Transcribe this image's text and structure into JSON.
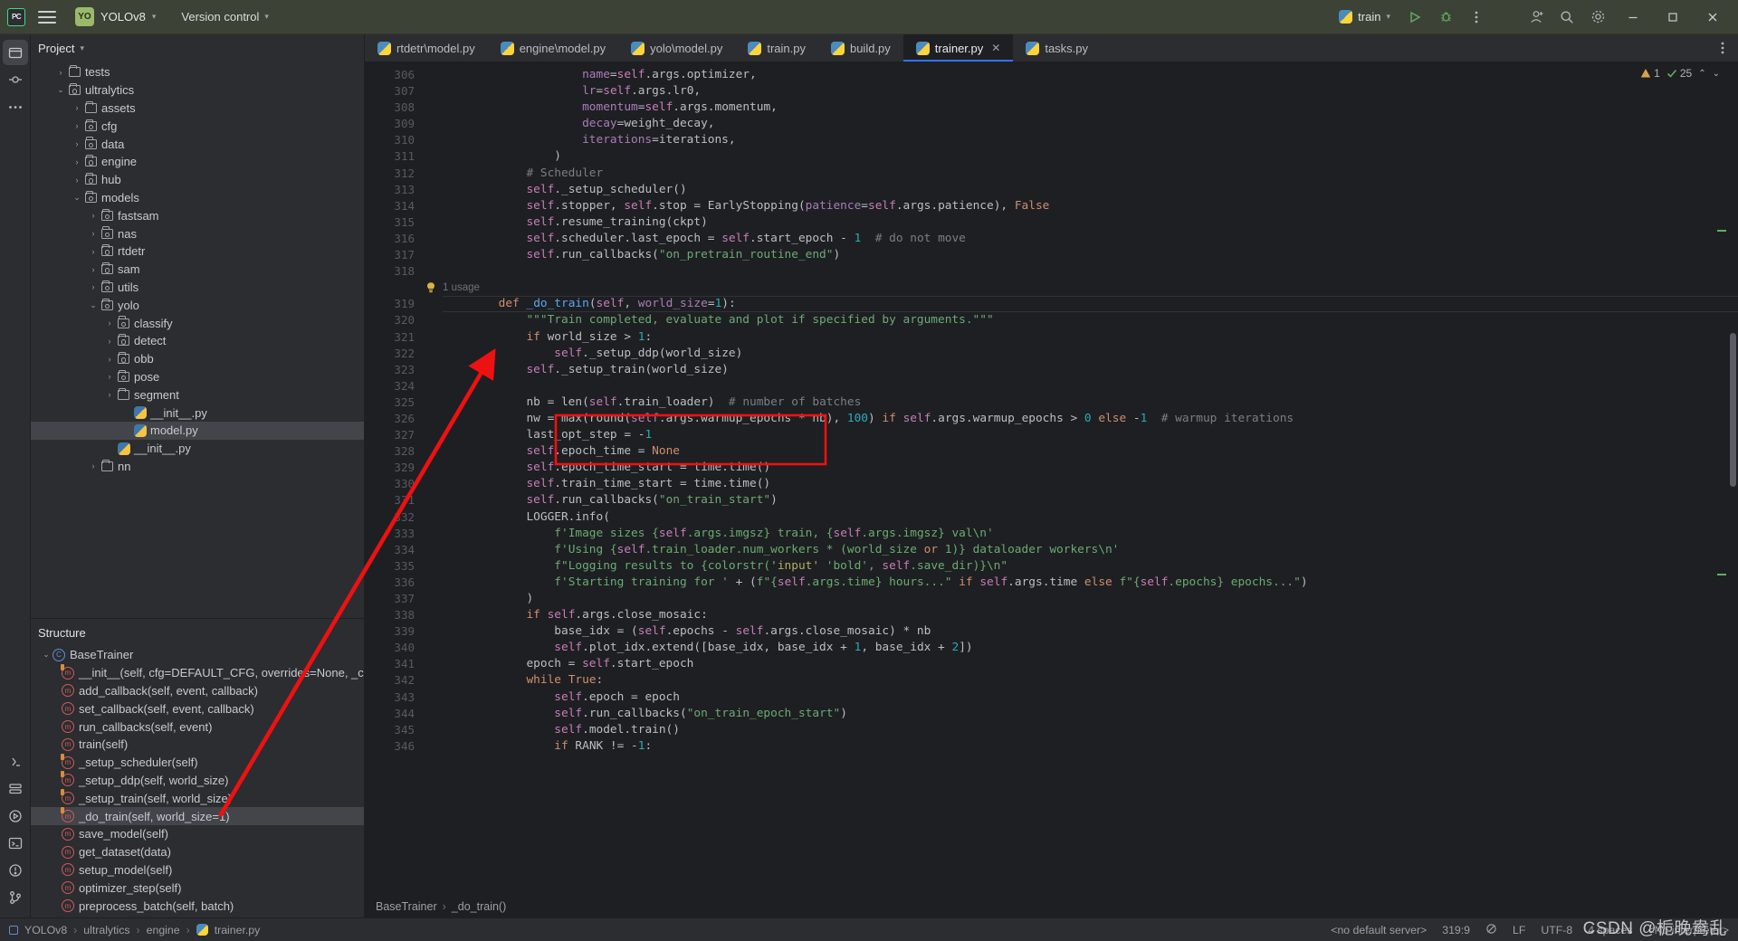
{
  "toolbar": {
    "app_icon": "pycharm-logo-icon",
    "menu_icon": "hamburger-menu-icon",
    "project_badge": "YO",
    "project_name": "YOLOv8",
    "version_control": "Version control",
    "run_config": "train",
    "run_icon": "run-play-icon",
    "debug_icon": "debug-bug-icon",
    "more_icon": "more-vertical-icon",
    "account_icon": "account-icon",
    "search_icon": "search-icon",
    "settings_icon": "gear-icon",
    "minimize": "window-minimize-icon",
    "maximize": "window-maximize-icon",
    "close": "window-close-icon"
  },
  "rail": {
    "top_icons": [
      "project-folder-icon",
      "commit-icon",
      "more-tools-icon"
    ],
    "bottom_icons": [
      "python-console-icon",
      "services-icon",
      "run-icon",
      "terminal-icon",
      "problems-icon",
      "git-branch-icon"
    ]
  },
  "project_panel": {
    "title": "Project",
    "chevron": "chevron-down-icon",
    "tree": [
      {
        "label": "tests",
        "depth": 1,
        "type": "folder",
        "twisty": "collapsed",
        "selected": false
      },
      {
        "label": "ultralytics",
        "depth": 1,
        "type": "source",
        "twisty": "expanded",
        "selected": false
      },
      {
        "label": "assets",
        "depth": 2,
        "type": "folder",
        "twisty": "collapsed",
        "selected": false
      },
      {
        "label": "cfg",
        "depth": 2,
        "type": "source",
        "twisty": "collapsed",
        "selected": false
      },
      {
        "label": "data",
        "depth": 2,
        "type": "source",
        "twisty": "collapsed",
        "selected": false
      },
      {
        "label": "engine",
        "depth": 2,
        "type": "source",
        "twisty": "collapsed",
        "selected": false
      },
      {
        "label": "hub",
        "depth": 2,
        "type": "source",
        "twisty": "collapsed",
        "selected": false
      },
      {
        "label": "models",
        "depth": 2,
        "type": "source",
        "twisty": "expanded",
        "selected": false
      },
      {
        "label": "fastsam",
        "depth": 3,
        "type": "source",
        "twisty": "collapsed",
        "selected": false
      },
      {
        "label": "nas",
        "depth": 3,
        "type": "source",
        "twisty": "collapsed",
        "selected": false
      },
      {
        "label": "rtdetr",
        "depth": 3,
        "type": "source",
        "twisty": "collapsed",
        "selected": false
      },
      {
        "label": "sam",
        "depth": 3,
        "type": "source",
        "twisty": "collapsed",
        "selected": false
      },
      {
        "label": "utils",
        "depth": 3,
        "type": "source",
        "twisty": "collapsed",
        "selected": false
      },
      {
        "label": "yolo",
        "depth": 3,
        "type": "source",
        "twisty": "expanded",
        "selected": false
      },
      {
        "label": "classify",
        "depth": 4,
        "type": "source",
        "twisty": "collapsed",
        "selected": false
      },
      {
        "label": "detect",
        "depth": 4,
        "type": "source",
        "twisty": "collapsed",
        "selected": false
      },
      {
        "label": "obb",
        "depth": 4,
        "type": "source",
        "twisty": "collapsed",
        "selected": false
      },
      {
        "label": "pose",
        "depth": 4,
        "type": "source",
        "twisty": "collapsed",
        "selected": false
      },
      {
        "label": "segment",
        "depth": 4,
        "type": "folder",
        "twisty": "collapsed",
        "selected": false
      },
      {
        "label": "__init__.py",
        "depth": 5,
        "type": "python",
        "twisty": "none",
        "selected": false
      },
      {
        "label": "model.py",
        "depth": 5,
        "type": "python",
        "twisty": "none",
        "selected": true
      },
      {
        "label": "__init__.py",
        "depth": 4,
        "type": "python",
        "twisty": "none",
        "selected": false
      },
      {
        "label": "nn",
        "depth": 3,
        "type": "folder",
        "twisty": "collapsed",
        "selected": false
      }
    ]
  },
  "structure_panel": {
    "title": "Structure",
    "items": [
      {
        "label": "BaseTrainer",
        "depth": 0,
        "kind": "class",
        "twisty": "expanded",
        "selected": false
      },
      {
        "label": "__init__(self, cfg=DEFAULT_CFG, overrides=None, _callbacks",
        "depth": 1,
        "kind": "method-private",
        "twisty": "none",
        "selected": false
      },
      {
        "label": "add_callback(self, event, callback)",
        "depth": 1,
        "kind": "method",
        "twisty": "none",
        "selected": false
      },
      {
        "label": "set_callback(self, event, callback)",
        "depth": 1,
        "kind": "method",
        "twisty": "none",
        "selected": false
      },
      {
        "label": "run_callbacks(self, event)",
        "depth": 1,
        "kind": "method",
        "twisty": "none",
        "selected": false
      },
      {
        "label": "train(self)",
        "depth": 1,
        "kind": "method",
        "twisty": "none",
        "selected": false
      },
      {
        "label": "_setup_scheduler(self)",
        "depth": 1,
        "kind": "method-private",
        "twisty": "none",
        "selected": false
      },
      {
        "label": "_setup_ddp(self, world_size)",
        "depth": 1,
        "kind": "method-private",
        "twisty": "none",
        "selected": false
      },
      {
        "label": "_setup_train(self, world_size)",
        "depth": 1,
        "kind": "method-private",
        "twisty": "none",
        "selected": false
      },
      {
        "label": "_do_train(self, world_size=1)",
        "depth": 1,
        "kind": "method-private",
        "twisty": "none",
        "selected": true
      },
      {
        "label": "save_model(self)",
        "depth": 1,
        "kind": "method",
        "twisty": "none",
        "selected": false
      },
      {
        "label": "get_dataset(data)",
        "depth": 1,
        "kind": "method",
        "twisty": "none",
        "selected": false
      },
      {
        "label": "setup_model(self)",
        "depth": 1,
        "kind": "method",
        "twisty": "none",
        "selected": false
      },
      {
        "label": "optimizer_step(self)",
        "depth": 1,
        "kind": "method",
        "twisty": "none",
        "selected": false
      },
      {
        "label": "preprocess_batch(self, batch)",
        "depth": 1,
        "kind": "method",
        "twisty": "none",
        "selected": false
      }
    ]
  },
  "tabs": {
    "items": [
      {
        "label": "rtdetr\\model.py",
        "active": false,
        "closable": false
      },
      {
        "label": "engine\\model.py",
        "active": false,
        "closable": false
      },
      {
        "label": "yolo\\model.py",
        "active": false,
        "closable": false
      },
      {
        "label": "train.py",
        "active": false,
        "closable": false
      },
      {
        "label": "build.py",
        "active": false,
        "closable": false
      },
      {
        "label": "trainer.py",
        "active": true,
        "closable": true
      },
      {
        "label": "tasks.py",
        "active": false,
        "closable": false
      }
    ],
    "more_icon": "more-vertical-icon"
  },
  "inspections": {
    "warning_icon": "warning-triangle-icon",
    "warning_count": "1",
    "ok_icon": "check-icon",
    "ok_count": "25",
    "prev_icon": "chevron-up-icon",
    "next_icon": "chevron-down-icon"
  },
  "editor": {
    "first_line_number": 306,
    "gutter_hint": "1 usage",
    "hint_icon": "lightbulb-icon",
    "lines": [
      {
        "n": 306,
        "html": "                    <span class='param'>name</span>=<span class='sf'>self</span>.args.optimizer,"
      },
      {
        "n": 307,
        "html": "                    <span class='param'>lr</span>=<span class='sf'>self</span>.args.lr0,"
      },
      {
        "n": 308,
        "html": "                    <span class='param'>momentum</span>=<span class='sf'>self</span>.args.momentum,"
      },
      {
        "n": 309,
        "html": "                    <span class='param'>decay</span>=weight_decay,"
      },
      {
        "n": 310,
        "html": "                    <span class='param'>iterations</span>=iterations,"
      },
      {
        "n": 311,
        "html": "                )"
      },
      {
        "n": 312,
        "html": "            <span class='cmt'># Scheduler</span>"
      },
      {
        "n": 313,
        "html": "            <span class='sf'>self</span>._setup_scheduler()"
      },
      {
        "n": 314,
        "html": "            <span class='sf'>self</span>.stopper, <span class='sf'>self</span>.stop = EarlyStopping(<span class='param'>patience</span>=<span class='sf'>self</span>.args.patience), <span class='kw'>False</span>"
      },
      {
        "n": 315,
        "html": "            <span class='sf'>self</span>.resume_training(ckpt)"
      },
      {
        "n": 316,
        "html": "            <span class='sf'>self</span>.scheduler.last_epoch = <span class='sf'>self</span>.start_epoch - <span class='num'>1</span>  <span class='cmt'># do not move</span>"
      },
      {
        "n": 317,
        "html": "            <span class='sf'>self</span>.run_callbacks(<span class='str'>\"on_pretrain_routine_end\"</span>)"
      },
      {
        "n": 318,
        "html": ""
      },
      {
        "n": "",
        "html": "",
        "usage": "1 usage"
      },
      {
        "n": 319,
        "html": "        <span class='kw'>def</span> <span class='fn'>_do_train</span>(<span class='sf'>self</span>, <span class='param'>world_size</span>=<span class='num'>1</span>):",
        "caret": true
      },
      {
        "n": 320,
        "html": "            <span class='str'>\"\"\"Train completed, evaluate and plot if specified by arguments.\"\"\"</span>"
      },
      {
        "n": 321,
        "html": "            <span class='kw'>if</span> world_size &gt; <span class='num'>1</span>:"
      },
      {
        "n": 322,
        "html": "                <span class='sf'>self</span>._setup_ddp(world_size)"
      },
      {
        "n": 323,
        "html": "            <span class='sf'>self</span>._setup_train(world_size)"
      },
      {
        "n": 324,
        "html": ""
      },
      {
        "n": 325,
        "html": "            nb = len(<span class='sf'>self</span>.train_loader)  <span class='cmt'># number of batches</span>"
      },
      {
        "n": 326,
        "html": "            nw = max(round(<span class='sf'>self</span>.args.warmup_epochs * nb), <span class='num'>100</span>) <span class='kw'>if</span> <span class='sf'>self</span>.args.warmup_epochs &gt; <span class='num'>0</span> <span class='kw'>else</span> -<span class='num'>1</span>  <span class='cmt'># warmup iterations</span>"
      },
      {
        "n": 327,
        "html": "            last_opt_step = -<span class='num'>1</span>"
      },
      {
        "n": 328,
        "html": "            <span class='sf'>self</span>.epoch_time = <span class='kw'>None</span>"
      },
      {
        "n": 329,
        "html": "            <span class='sf'>self</span>.epoch_time_start = time.time()"
      },
      {
        "n": 330,
        "html": "            <span class='sf'>self</span>.train_time_start = time.time()"
      },
      {
        "n": 331,
        "html": "            <span class='sf'>self</span>.run_callbacks(<span class='str'>\"on_train_start\"</span>)"
      },
      {
        "n": 332,
        "html": "            LOGGER.info("
      },
      {
        "n": 333,
        "html": "                <span class='fstr'>f'Image sizes {</span><span class='sf'>self</span><span class='fstr'>.args.imgsz} train, {</span><span class='sf'>self</span><span class='fstr'>.args.imgsz} val\\n'</span>"
      },
      {
        "n": 334,
        "html": "                <span class='fstr'>f'Using {</span><span class='sf'>self</span><span class='fstr'>.train_loader.num_workers * (world_size </span><span class='kw'>or</span><span class='fstr'> 1)} dataloader workers\\n'</span>"
      },
      {
        "n": 335,
        "html": "                <span class='fstr'>f\"Logging results to {colorstr(</span><span class='deco'>'input'</span><span class='fstr'> 'bold', </span><span class='sf'>self</span><span class='fstr'>.save_dir)}\\n\"</span>"
      },
      {
        "n": 336,
        "html": "                <span class='fstr'>f'Starting training for '</span> + (<span class='fstr'>f\"{</span><span class='sf'>self</span><span class='fstr'>.args.time} hours...\"</span> <span class='kw'>if</span> <span class='sf'>self</span>.args.time <span class='kw'>else</span> <span class='fstr'>f\"{</span><span class='sf'>self</span><span class='fstr'>.epochs} epochs...\"</span>)"
      },
      {
        "n": 337,
        "html": "            )"
      },
      {
        "n": 338,
        "html": "            <span class='kw'>if</span> <span class='sf'>self</span>.args.close_mosaic:"
      },
      {
        "n": 339,
        "html": "                base_idx = (<span class='sf'>self</span>.epochs - <span class='sf'>self</span>.args.close_mosaic) * nb"
      },
      {
        "n": 340,
        "html": "                <span class='sf'>self</span>.plot_idx.extend([base_idx, base_idx + <span class='num'>1</span>, base_idx + <span class='num'>2</span>])"
      },
      {
        "n": 341,
        "html": "            epoch = <span class='sf'>self</span>.start_epoch"
      },
      {
        "n": 342,
        "html": "            <span class='kw'>while</span> <span class='kw'>True</span>:"
      },
      {
        "n": 343,
        "html": "                <span class='sf'>self</span>.epoch = epoch"
      },
      {
        "n": 344,
        "html": "                <span class='sf'>self</span>.run_callbacks(<span class='str'>\"on_train_epoch_start\"</span>)"
      },
      {
        "n": 345,
        "html": "                <span class='sf'>self</span>.model.train()"
      },
      {
        "n": 346,
        "html": "                <span class='kw'>if</span> RANK != -<span class='num'>1</span>:"
      }
    ]
  },
  "annotation": {
    "highlight_box": "red-rectangle-highlight",
    "arrow": "red-arrow-pointer",
    "highlight_target_line": "self._setup_train(world_size)",
    "arrow_target": "_do_train(self, world_size=1)",
    "color": "#ee1111"
  },
  "breadcrumbs": {
    "items": [
      "BaseTrainer",
      "_do_train()"
    ],
    "separator": "›"
  },
  "status_bar": {
    "path": [
      "YOLOv8",
      "ultralytics",
      "engine",
      "trainer.py"
    ],
    "separator": "›",
    "file_icon": "python-file-icon",
    "project_icon": "project-icon",
    "right": {
      "server": "<no default server>",
      "caret": "319:9",
      "inspection_icon": "inspection-off-icon",
      "line_sep": "LF",
      "encoding": "UTF-8",
      "indent": "4 spaces",
      "interpreter": "<No interpreter>"
    }
  },
  "watermark": "CSDN @栀晚鸯乱",
  "colors": {
    "accent_blue": "#3574f0",
    "toolbar_green": "#3c4236",
    "editor_bg": "#1e1f22",
    "panel_bg": "#2b2d30",
    "annotation_red": "#ee1111",
    "selection": "#43454a"
  }
}
